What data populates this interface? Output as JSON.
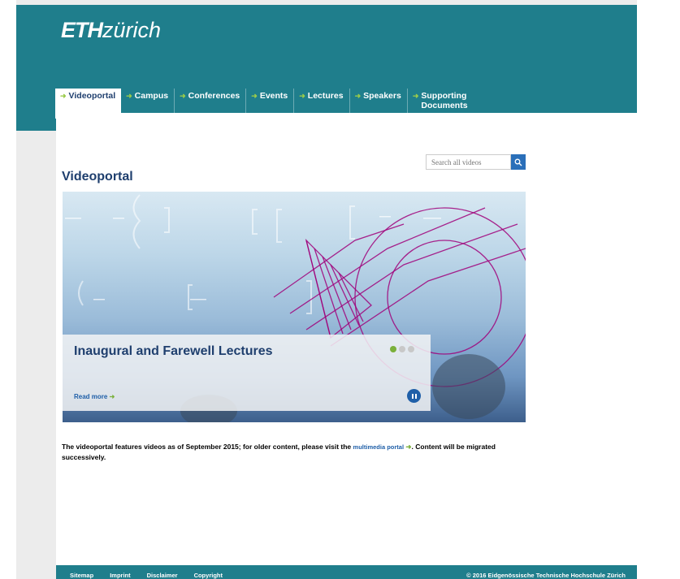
{
  "logo": {
    "eth": "ETH",
    "zurich": "zürich"
  },
  "nav": {
    "items": [
      {
        "label": "Videoportal"
      },
      {
        "label": "Campus"
      },
      {
        "label": "Conferences"
      },
      {
        "label": "Events"
      },
      {
        "label": "Lectures"
      },
      {
        "label": "Speakers"
      },
      {
        "label": "Supporting Documents"
      }
    ]
  },
  "search": {
    "placeholder": "Search all videos"
  },
  "page_title": "Videoportal",
  "hero": {
    "caption_title": "Inaugural and Farewell Lectures",
    "read_more": "Read more",
    "slide_count": 3,
    "active_slide": 1
  },
  "intro": {
    "text_before": "The videoportal features videos as of September 2015; for older content, please visit the ",
    "link": "multimedia portal",
    "text_after": ". Content will be migrated successively."
  },
  "footer": {
    "links": [
      "Sitemap",
      "Imprint",
      "Disclaimer",
      "Copyright"
    ],
    "copyright": "© 2016 Eidgenössische Technische Hochschule Zürich"
  },
  "colors": {
    "brand": "#1f7e8c",
    "title": "#1f3f6e",
    "link": "#1f5fa8",
    "accent": "#7ab03a"
  }
}
